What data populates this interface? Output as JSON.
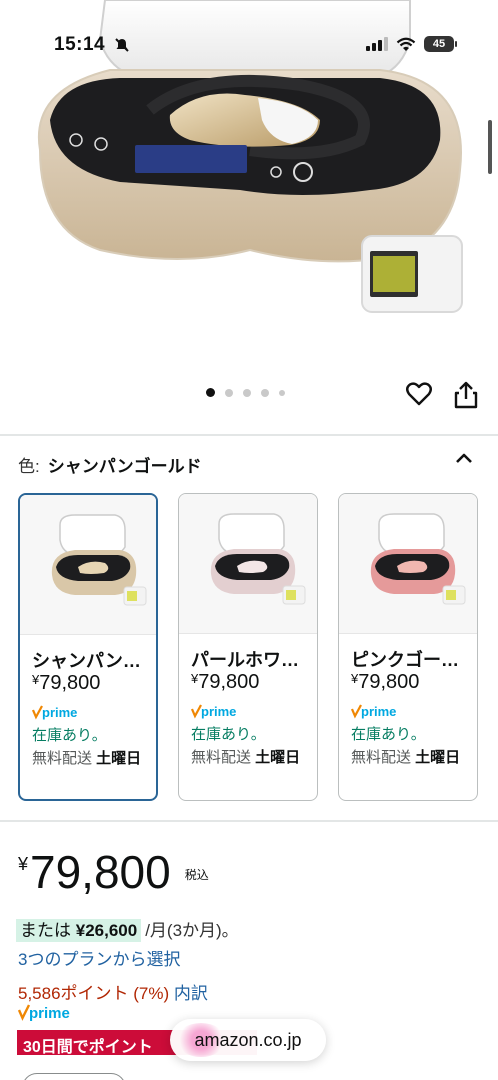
{
  "status": {
    "time": "15:14",
    "battery": "45"
  },
  "carousel": {
    "dot_count": 5,
    "active_index": 0
  },
  "color": {
    "label": "色:",
    "selected": "シャンパンゴールド"
  },
  "variants": [
    {
      "name": "シャンパンゴールド",
      "yen": "¥",
      "price": "79,800",
      "prime": "prime",
      "stock": "在庫あり。",
      "ship_prefix": "無料配送 ",
      "ship_day": "土曜日",
      "body_color": "#d9c7a8",
      "selected": true
    },
    {
      "name": "パールホワイト",
      "yen": "¥",
      "price": "79,800",
      "prime": "prime",
      "stock": "在庫あり。",
      "ship_prefix": "無料配送 ",
      "ship_day": "土曜日",
      "body_color": "#e3cfd0",
      "selected": false
    },
    {
      "name": "ピンクゴールド",
      "yen": "¥",
      "price": "79,800",
      "prime": "prime",
      "stock": "在庫あり。",
      "ship_prefix": "無料配送 ",
      "ship_day": "土曜日",
      "body_color": "#e59a9a",
      "selected": false
    }
  ],
  "price": {
    "yen": "¥",
    "value": "79,800",
    "tax": "税込"
  },
  "installment": {
    "prefix": "または",
    "amount": "¥26,600",
    "suffix": "/月(3か月)。"
  },
  "plan_link": "3つのプランから選択",
  "points": {
    "text": "5,586ポイント (7%)",
    "link": "内訳"
  },
  "prime_label": "prime",
  "promo": "30日間でポイント",
  "url": "amazon.co.jp",
  "colors": {
    "link": "#2162a1",
    "stock": "#067d62",
    "points": "#b12704",
    "promo": "#cc0c39",
    "selected_border": "#2a6596",
    "prime": "#00a8e1"
  }
}
